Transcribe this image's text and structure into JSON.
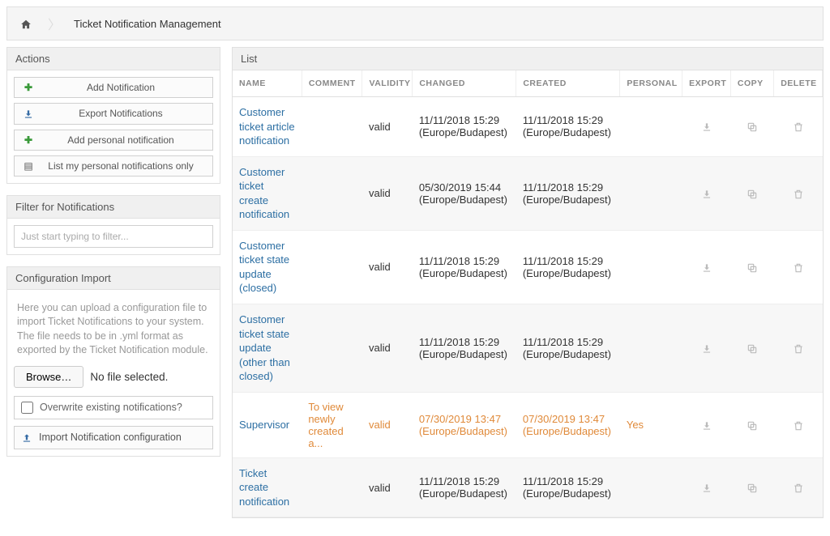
{
  "breadcrumb": {
    "title": "Ticket Notification Management"
  },
  "sidebar": {
    "actions": {
      "header": "Actions",
      "items": [
        {
          "icon": "plus-icon",
          "label": "Add Notification"
        },
        {
          "icon": "download-icon",
          "label": "Export Notifications"
        },
        {
          "icon": "plus-icon",
          "label": "Add personal notification"
        },
        {
          "icon": "list-icon",
          "label": "List my personal notifications only"
        }
      ]
    },
    "filter": {
      "header": "Filter for Notifications",
      "placeholder": "Just start typing to filter..."
    },
    "config_import": {
      "header": "Configuration Import",
      "description": "Here you can upload a configuration file to import Ticket Notifications to your system. The file needs to be in .yml format as exported by the Ticket Notification module.",
      "browse_label": "Browse…",
      "no_file": "No file selected.",
      "overwrite_label": "Overwrite existing notifications?",
      "import_label": "Import Notification configuration"
    }
  },
  "list": {
    "header": "List",
    "columns": {
      "name": "NAME",
      "comment": "COMMENT",
      "validity": "VALIDITY",
      "changed": "CHANGED",
      "created": "CREATED",
      "personal": "PERSONAL",
      "export": "EXPORT",
      "copy": "COPY",
      "delete": "DELETE"
    },
    "rows": [
      {
        "name": "Customer ticket article notification",
        "comment": "",
        "validity": "valid",
        "changed": "11/11/2018 15:29 (Europe/Budapest)",
        "created": "11/11/2018 15:29 (Europe/Budapest)",
        "personal": "",
        "highlight": false
      },
      {
        "name": "Customer ticket create notification",
        "comment": "",
        "validity": "valid",
        "changed": "05/30/2019 15:44 (Europe/Budapest)",
        "created": "11/11/2018 15:29 (Europe/Budapest)",
        "personal": "",
        "highlight": false
      },
      {
        "name": "Customer ticket state update (closed)",
        "comment": "",
        "validity": "valid",
        "changed": "11/11/2018 15:29 (Europe/Budapest)",
        "created": "11/11/2018 15:29 (Europe/Budapest)",
        "personal": "",
        "highlight": false
      },
      {
        "name": "Customer ticket state update (other than closed)",
        "comment": "",
        "validity": "valid",
        "changed": "11/11/2018 15:29 (Europe/Budapest)",
        "created": "11/11/2018 15:29 (Europe/Budapest)",
        "personal": "",
        "highlight": false
      },
      {
        "name": "Supervisor",
        "comment": "To view newly created a...",
        "validity": "valid",
        "changed": "07/30/2019 13:47 (Europe/Budapest)",
        "created": "07/30/2019 13:47 (Europe/Budapest)",
        "personal": "Yes",
        "highlight": true
      },
      {
        "name": "Ticket create notification",
        "comment": "",
        "validity": "valid",
        "changed": "11/11/2018 15:29 (Europe/Budapest)",
        "created": "11/11/2018 15:29 (Europe/Budapest)",
        "personal": "",
        "highlight": false
      }
    ]
  }
}
